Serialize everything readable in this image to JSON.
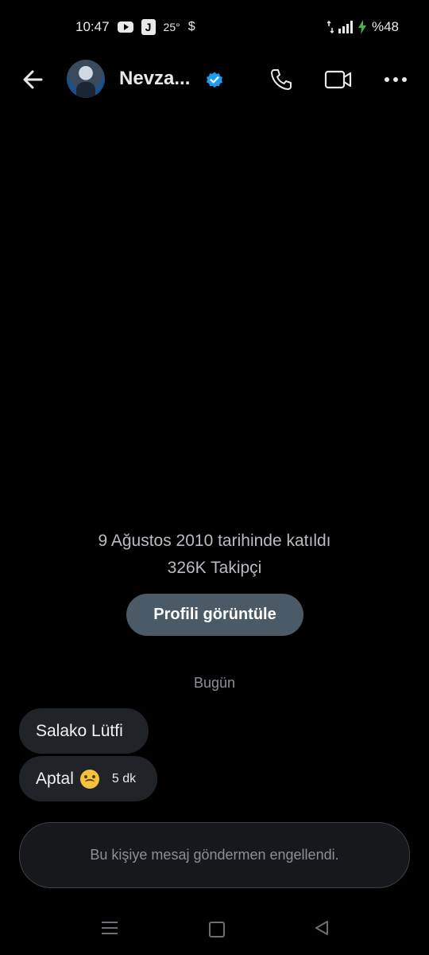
{
  "status_bar": {
    "time": "10:47",
    "temperature": "25°",
    "dollar": "$",
    "battery": "%48",
    "icons": [
      "youtube-icon",
      "j-app-icon",
      "dollar-icon",
      "data-arrows-icon",
      "signal-icon",
      "charging-icon"
    ]
  },
  "header": {
    "name": "Nevza...",
    "verified": true,
    "icons": [
      "back-arrow-icon",
      "verified-badge-icon",
      "phone-icon",
      "video-camera-icon",
      "more-dots-icon"
    ]
  },
  "profile": {
    "joined": "9 Ağustos 2010 tarihinde katıldı",
    "followers": "326K Takipçi",
    "view_profile_label": "Profili görüntüle"
  },
  "conversation": {
    "day_separator": "Bugün",
    "messages": [
      {
        "text": "Salako Lütfi"
      },
      {
        "text": "Aptal",
        "emoji": "upside-down-face-icon",
        "time": "5 dk"
      }
    ]
  },
  "composer": {
    "blocked_text": "Bu kişiye mesaj göndermen engellendi."
  },
  "colors": {
    "background": "#000000",
    "bubble": "#202327",
    "button": "#4a5a66",
    "verified": "#1d9bf0"
  }
}
